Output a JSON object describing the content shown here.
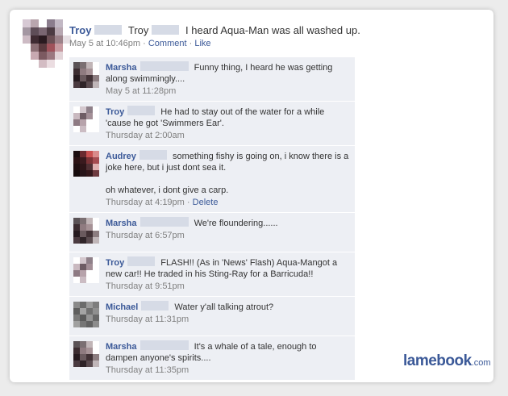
{
  "post": {
    "author": "Troy",
    "target": "Troy",
    "text": "I heard Aqua-Man was all washed up.",
    "timestamp": "May 5 at 10:46pm",
    "sep": "·",
    "comment_label": "Comment",
    "like_label": "Like",
    "avatar_colors": [
      "#d7c9d4",
      "#b9a6ae",
      "#ffffff",
      "#8b7d8d",
      "#c2b8c4",
      "#ffffff",
      "#a497a2",
      "#5e4d57",
      "#7a6672",
      "#4c3b43",
      "#b7a7b1",
      "#ffffff",
      "#cdbbc4",
      "#3f2b32",
      "#2a1a20",
      "#6b4f55",
      "#9c828a",
      "#e6dfe3",
      "#ffffff",
      "#8c6f75",
      "#5b3a3f",
      "#a0525b",
      "#c79aa1",
      "#ffffff",
      "#ffffff",
      "#c8a9b1",
      "#7c5a61",
      "#9b7880",
      "#e2d4d8",
      "#ffffff",
      "#ffffff",
      "#ffffff",
      "#d3bcc3",
      "#ebdde1",
      "#ffffff",
      "#ffffff"
    ]
  },
  "comments": [
    {
      "author": "Marsha",
      "blur": "long",
      "text": "Funny thing, I heard he was getting along swimmingly....",
      "time": "May 5 at 11:28pm",
      "action": "",
      "avatar_colors": [
        "#5a5256",
        "#7b6f72",
        "#c1b5b7",
        "#ffffff",
        "#3b2c31",
        "#8f7b80",
        "#a69296",
        "#ffffff",
        "#251a1f",
        "#6a5a5e",
        "#423236",
        "#8c7d80",
        "#4a3a40",
        "#2f2428",
        "#5b4c50",
        "#c0b6b8"
      ]
    },
    {
      "author": "Troy",
      "blur": "short",
      "text": "He had to stay out of the water for a while 'cause he got 'Swimmers Ear'.",
      "time": "Thursday at 2:00am",
      "action": "",
      "avatar_colors": [
        "#ffffff",
        "#d4c8ce",
        "#8f8089",
        "#ffffff",
        "#c9b9c0",
        "#6e5c64",
        "#a38f97",
        "#ffffff",
        "#8d7a83",
        "#b7a3ab",
        "#ffffff",
        "#ffffff",
        "#ffffff",
        "#cbbcc3",
        "#ffffff",
        "#ffffff"
      ]
    },
    {
      "author": "Audrey",
      "blur": "short",
      "text": "something fishy is going on, i know there is a joke here, but i just dont sea it.\n\noh whatever, i dont give a carp.",
      "time": "Thursday at 4:19pm",
      "action": "Delete",
      "avatar_colors": [
        "#1a0d10",
        "#6a2a2f",
        "#c85050",
        "#d98a8a",
        "#2a1215",
        "#3a1a1e",
        "#7a3236",
        "#a54b50",
        "#1d0e11",
        "#2e1518",
        "#503034",
        "#e0b0b0",
        "#140a0c",
        "#27151a",
        "#34181c",
        "#6e3b40"
      ]
    },
    {
      "author": "Marsha",
      "blur": "long",
      "text": "We're floundering......",
      "time": "Thursday at 6:57pm",
      "action": "",
      "avatar_colors": [
        "#5a5256",
        "#7b6f72",
        "#c1b5b7",
        "#ffffff",
        "#3b2c31",
        "#8f7b80",
        "#a69296",
        "#ffffff",
        "#251a1f",
        "#6a5a5e",
        "#423236",
        "#8c7d80",
        "#4a3a40",
        "#2f2428",
        "#5b4c50",
        "#c0b6b8"
      ]
    },
    {
      "author": "Troy",
      "blur": "short",
      "text": "FLASH!! (As in 'News' Flash) Aqua-Mangot a new car!! He traded in his Sting-Ray for a Barricuda!!",
      "time": "Thursday at 9:51pm",
      "action": "",
      "avatar_colors": [
        "#ffffff",
        "#d4c8ce",
        "#8f8089",
        "#ffffff",
        "#c9b9c0",
        "#6e5c64",
        "#a38f97",
        "#ffffff",
        "#8d7a83",
        "#b7a3ab",
        "#ffffff",
        "#ffffff",
        "#ffffff",
        "#cbbcc3",
        "#ffffff",
        "#ffffff"
      ]
    },
    {
      "author": "Michael",
      "blur": "short",
      "text": "Water y'all talking atrout?",
      "time": "Thursday at 11:31pm",
      "action": "",
      "avatar_colors": [
        "#8a8a8a",
        "#6b6b6b",
        "#9a9a9a",
        "#7d7d7d",
        "#5e5e5e",
        "#a3a3a3",
        "#707070",
        "#8f8f8f",
        "#7a7a7a",
        "#5a5a5a",
        "#949494",
        "#686868",
        "#a0a0a0",
        "#767676",
        "#626262",
        "#8c8c8c"
      ]
    },
    {
      "author": "Marsha",
      "blur": "long",
      "text": "It's a whale of a tale, enough to dampen anyone's spirits....",
      "time": "Thursday at 11:35pm",
      "action": "",
      "avatar_colors": [
        "#5a5256",
        "#7b6f72",
        "#c1b5b7",
        "#ffffff",
        "#3b2c31",
        "#8f7b80",
        "#a69296",
        "#ffffff",
        "#251a1f",
        "#6a5a5e",
        "#423236",
        "#8c7d80",
        "#4a3a40",
        "#2f2428",
        "#5b4c50",
        "#c0b6b8"
      ]
    }
  ],
  "watermark": {
    "main": "lamebook",
    "suffix": ".com"
  },
  "colors": {
    "link": "#3b5998",
    "comment_bg": "#edeff4",
    "meta": "#808080"
  }
}
